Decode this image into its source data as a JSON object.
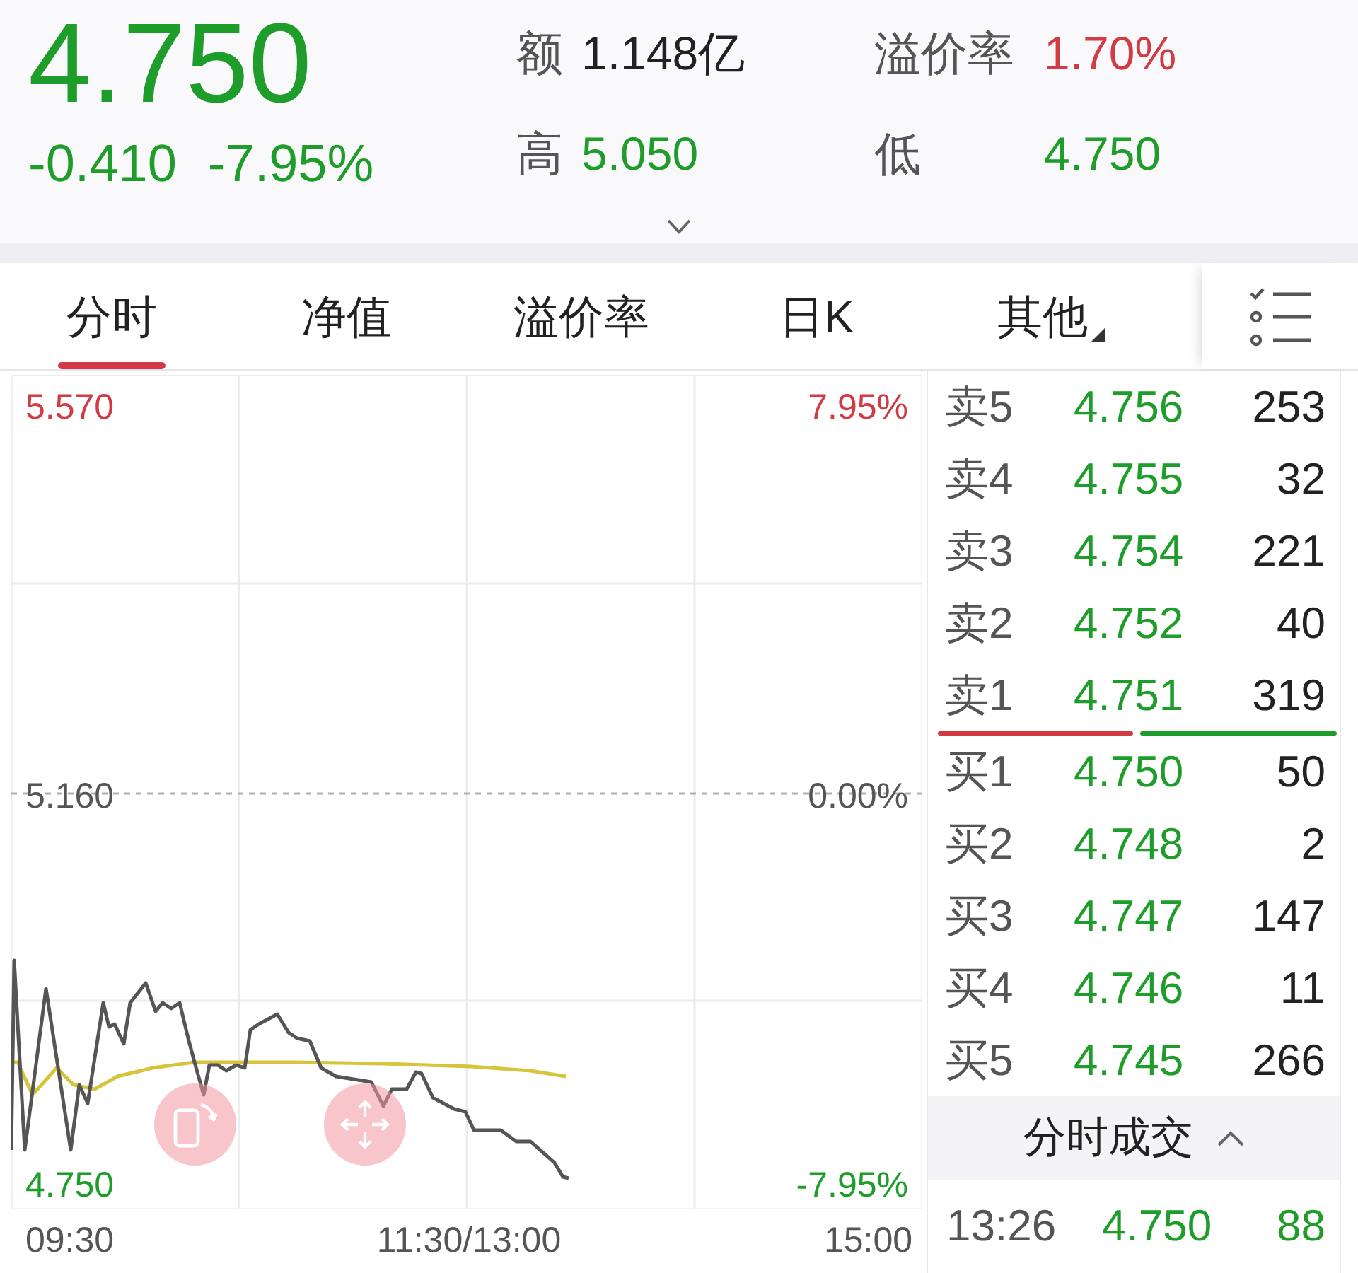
{
  "quote": {
    "price": "4.750",
    "change": "-0.410",
    "change_percent": "-7.95%",
    "color": "#1f9d2a",
    "stats": [
      {
        "label": "额",
        "value": "1.148亿",
        "color": "#222222"
      },
      {
        "label": "溢价率",
        "value": "1.70%",
        "color": "#d23b44"
      },
      {
        "label": "高",
        "value": "5.050",
        "color": "#1f9d2a"
      },
      {
        "label": "低",
        "value": "4.750",
        "color": "#1f9d2a"
      }
    ]
  },
  "tabs": [
    {
      "label": "分时",
      "selected": true,
      "kind": "plain"
    },
    {
      "label": "净值",
      "selected": false,
      "kind": "plain"
    },
    {
      "label": "溢价率",
      "selected": false,
      "kind": "plain"
    },
    {
      "label": "日K",
      "selected": false,
      "kind": "plain"
    },
    {
      "label": "其他",
      "selected": false,
      "kind": "dropdown"
    }
  ],
  "chart": {
    "axis_rows": [
      {
        "price": "5.570",
        "percent": "7.95%",
        "color": "#d23b44"
      },
      {
        "price": "5.160",
        "percent": "0.00%",
        "color": "#555555"
      },
      {
        "price": "4.750",
        "percent": "-7.95%",
        "color": "#1f9d2a"
      }
    ],
    "time_labels": [
      "09:30",
      "11:30/13:00",
      "15:00"
    ]
  },
  "order_book": {
    "asks": [
      {
        "label": "卖5",
        "price": "4.756",
        "volume": "253"
      },
      {
        "label": "卖4",
        "price": "4.755",
        "volume": "32"
      },
      {
        "label": "卖3",
        "price": "4.754",
        "volume": "221"
      },
      {
        "label": "卖2",
        "price": "4.752",
        "volume": "40"
      },
      {
        "label": "卖1",
        "price": "4.751",
        "volume": "319"
      }
    ],
    "bids": [
      {
        "label": "买1",
        "price": "4.750",
        "volume": "50"
      },
      {
        "label": "买2",
        "price": "4.748",
        "volume": "2"
      },
      {
        "label": "买3",
        "price": "4.747",
        "volume": "147"
      },
      {
        "label": "买4",
        "price": "4.746",
        "volume": "11"
      },
      {
        "label": "买5",
        "price": "4.745",
        "volume": "266"
      }
    ]
  },
  "trades": {
    "title": "分时成交",
    "rows": [
      {
        "time": "13:26",
        "price": "4.750",
        "volume": "88"
      }
    ]
  }
}
